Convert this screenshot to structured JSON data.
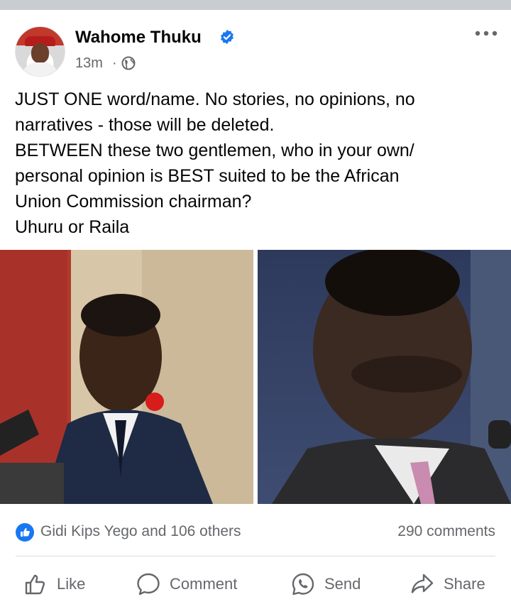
{
  "post": {
    "author": "Wahome Thuku",
    "timestamp": "13m",
    "separator": "·",
    "text_lines": [
      "JUST ONE word/name. No stories, no opinions, no",
      "narratives - those will be deleted.",
      "BETWEEN these two gentlemen, who in your own/",
      "personal opinion is BEST suited to be the African",
      "Union Commission chairman?",
      "Uhuru or Raila"
    ]
  },
  "stats": {
    "reactions": "Gidi Kips Yego and 106 others",
    "comments": "290 comments"
  },
  "actions": {
    "like": "Like",
    "comment": "Comment",
    "send": "Send",
    "share": "Share"
  },
  "icons": [
    "verified-icon",
    "globe-icon",
    "more-icon",
    "like-reaction-icon",
    "thumbs-up-icon",
    "comment-bubble-icon",
    "whatsapp-icon",
    "share-arrow-icon"
  ],
  "colors": {
    "brand_blue": "#1877f2",
    "secondary_text": "#65676b",
    "divider": "#c9ccd1"
  }
}
